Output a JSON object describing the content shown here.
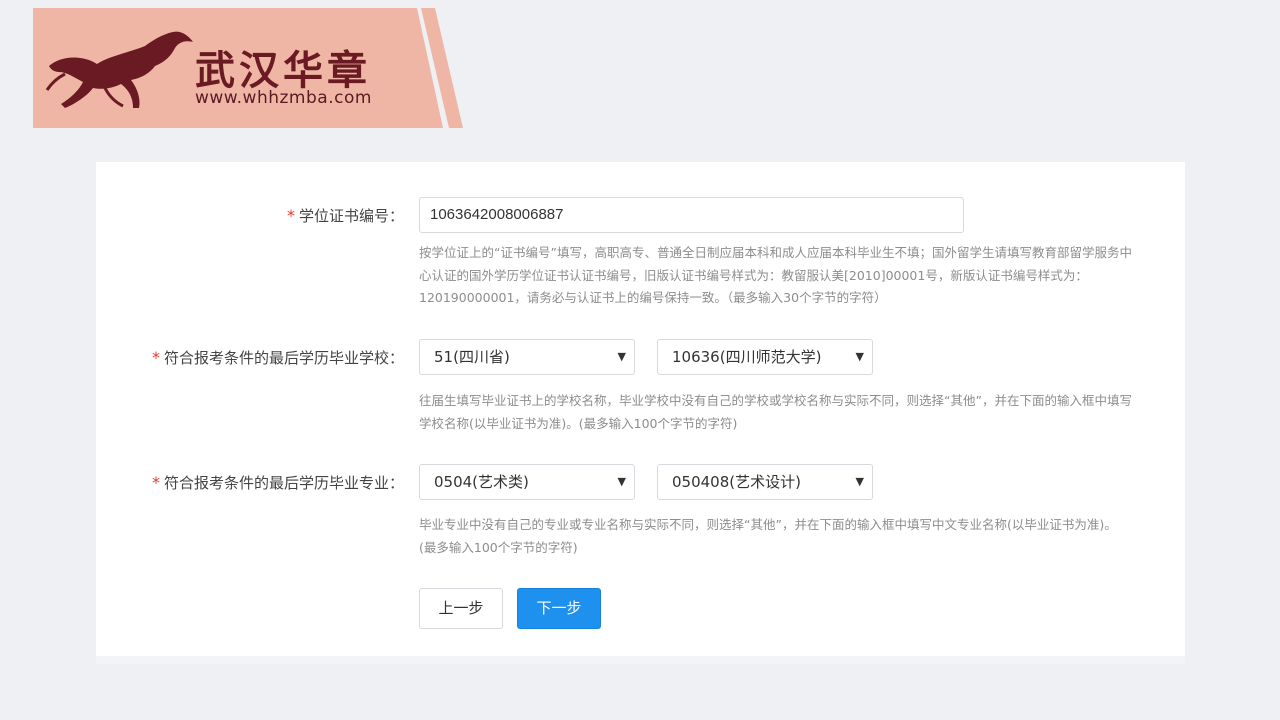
{
  "brand": {
    "name": "武汉华章",
    "url": "www.whhzmba.com"
  },
  "form": {
    "degree_cert": {
      "required_mark": "*",
      "label": "学位证书编号：",
      "value": "1063642008006887",
      "help": "按学位证上的“证书编号”填写，高职高专、普通全日制应届本科和成人应届本科毕业生不填；国外留学生请填写教育部留学服务中心认证的国外学历学位证书认证书编号，旧版认证书编号样式为：教留服认美[2010]00001号，新版认证书编号样式为：120190000001，请务必与认证书上的编号保持一致。（最多输入30个字节的字符）"
    },
    "school": {
      "required_mark": "*",
      "label": "符合报考条件的最后学历毕业学校：",
      "province_selected": "51(四川省)",
      "school_selected": "10636(四川师范大学)",
      "help": "往届生填写毕业证书上的学校名称，毕业学校中没有自己的学校或学校名称与实际不同，则选择“其他”，并在下面的输入框中填写学校名称(以毕业证书为准)。(最多输入100个字节的字符)"
    },
    "major": {
      "required_mark": "*",
      "label": "符合报考条件的最后学历毕业专业：",
      "category_selected": "0504(艺术类)",
      "major_selected": "050408(艺术设计)",
      "help": "毕业专业中没有自己的专业或专业名称与实际不同，则选择“其他”，并在下面的输入框中填写中文专业名称(以毕业证书为准)。(最多输入100个字节的字符)"
    },
    "buttons": {
      "prev": "上一步",
      "next": "下一步"
    }
  },
  "colors": {
    "banner_bg": "#efb6a6",
    "brand_text": "#6a1a22",
    "primary": "#1e90ee",
    "required": "#e23a2a"
  },
  "icons": {
    "logo": "horse-icon",
    "select_arrow": "triangle-down-icon"
  }
}
